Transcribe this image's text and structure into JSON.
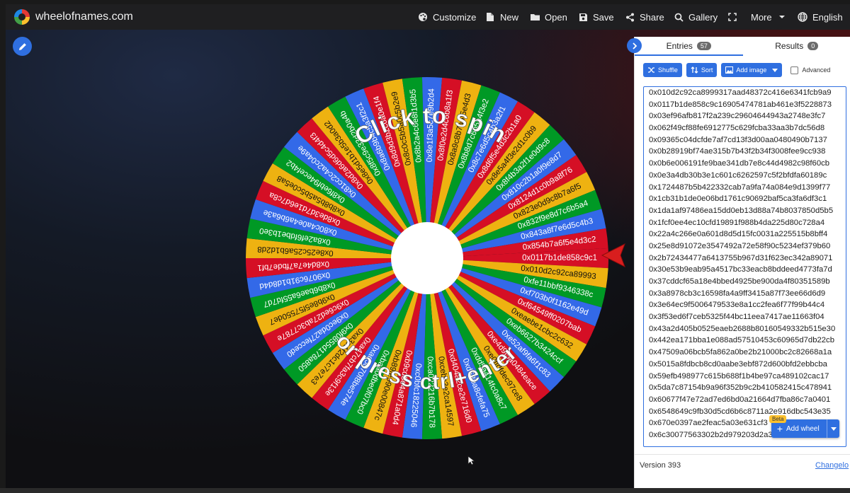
{
  "topbar": {
    "brand": "wheelofnames.com",
    "menu": [
      {
        "label": "Customize",
        "icon": "palette-icon"
      },
      {
        "label": "New",
        "icon": "file-icon"
      },
      {
        "label": "Open",
        "icon": "folder-icon"
      },
      {
        "label": "Save",
        "icon": "save-icon"
      },
      {
        "label": "Share",
        "icon": "share-icon"
      },
      {
        "label": "Gallery",
        "icon": "search-icon"
      },
      {
        "label": "",
        "icon": "fullscreen-icon"
      },
      {
        "label": "More",
        "icon": "chevron-down-icon"
      },
      {
        "label": "English",
        "icon": "globe-icon"
      }
    ]
  },
  "wheel": {
    "line1": "Click to spin",
    "line2": "or press ctrl+enter",
    "slice_colors": [
      "#3369e8",
      "#d50f25",
      "#eeb211",
      "#009925"
    ],
    "slice_labels": [
      "0x0117b1de858c9c1",
      "0x010d2c92ca89993",
      "0xfe11bbf9346338c",
      "0xf703b0f1162e49d",
      "0xf64549ff0207bab",
      "0xeaebe1cbc2c632",
      "0xeb6627b3424ccf",
      "0xe52af9fa6f1c83",
      "0xe4d9f5a0484eace",
      "0xe0ffdfdec97ce8",
      "0xdd5a414fc0a8c7",
      "0xd68ba8cfefa75",
      "0xd404a2ce2e716d0",
      "0xcebc3e2ca14597",
      "0xca022216b7b178",
      "0xc0bfc18225046",
      "0xb9cd8e4a871a0d4",
      "0xb89fe990e00847c",
      "0xbaa0dbe0f07bc0",
      "0xad5870f8be574e",
      "0xa47cb7fa3c9f13e",
      "0xa3e1f2dc1c7e7e3",
      "0x9f0855d178a850",
      "0x9ec0da27fecced0",
      "0x9c6ed27ab3c7787e",
      "0x9b8e5f57550de7",
      "0x8b6bae6a55fd7d7",
      "0x9076c91b1d8d4d",
      "0x8d4e7a7fbde7bf1",
      "0x8e25c25a6b1d2d8",
      "0x8a2ef6fdbe1b3e0",
      "0x80c4a0e4a6b6a3e",
      "0x8de3d7d1e6d7c8a",
      "0x8b8b5a5b5c0e5a8",
      "0x8f6ebf94ecef4b2",
      "0x81cc2c4a2c04a9e",
      "0x8d2a6d6d5c4d4f3",
      "0x8e5d1b1e5b3a0d2",
      "0x8f5c9e33d2b0a4b",
      "0x8a6b9b4c5a3f2c1",
      "0x8d9d3b2c6a0e1f4",
      "0x8c0c5b5a0c5b2e9",
      "0x8b2a4c6e8f1d3b5",
      "0x8e1f3a5c7e9b2d4",
      "0x8f0e2d4c6b8a1f3",
      "0x8a9c8b7a6f5e4d3",
      "0x8b8d7c6b5a4f3e2",
      "0x8c7e6d5c4b3a2f1",
      "0x8d6f5e4d3c2b1a0",
      "0x8e5a4f3e2d1c0b9",
      "0x8f4b3a2f1e0d9c8",
      "0x810c2b1a0f9e8d7",
      "0x8124d1c0b9a8f76",
      "0x823e0d9c8b7a6f5",
      "0x832f9e8d7c6b5a4",
      "0x843a8f7e6d5c4b3",
      "0x854b7a6f5e4d3c2"
    ]
  },
  "panel": {
    "tabs": [
      {
        "label": "Entries",
        "count": "57"
      },
      {
        "label": "Results",
        "count": "0"
      }
    ],
    "buttons": {
      "shuffle": "Shuffle",
      "sort": "Sort",
      "add_image": "Add image",
      "advanced": "Advanced"
    },
    "entries": [
      "0x010d2c92ca8999317aad48372c416e6341fcb9a9",
      "0x0117b1de858c9c16905474781ab461e3f5228873",
      "0x03ef96afb817f2a239c29604644943a2748e3fc7",
      "0x062f49cf88fe6912775c629fcba33aa3b7dc56d8",
      "0x09365c04dcfde7af7cd13f3d00aa0480490b7137",
      "0x0b28919bf74ae315b7b43f2b34f3008fee9cc938",
      "0x0b6e006191fe9bae341db7e8c44d4982c98f60cb",
      "0x0e3a4db30b3e1c601c6262597c5f2bfdfa60189c",
      "0x1724487b5b422332cab7a9fa74a084e9d1399f77",
      "0x1cb31b1de0e06bd1761c90692baf5ca3fa6df3c1",
      "0x1da1af97486ea15dd0eb13d88a74b8037850d5b5",
      "0x1fcf0ee4ec10cfd19891f988b4da225d80c728a4",
      "0x22a4c266e0a601d8d5d15fc0031a225515b8bff4",
      "0x25e8d91072e3547492a72e58f90c5234ef379b60",
      "0x2b72434477a6413755b967d31f623ec342a89071",
      "0x30e53b9eab95a4517bc33eacb8bddeed4773fa7d",
      "0x37cddcf65a18e4bbed4925be900da4f80351589b",
      "0x3a8978cb3c16598fa4a9ff3415a87f73ee66d6d9",
      "0x3e64ec9f5006479533e8a1cc2fea6f77f99b44c4",
      "0x3f53ed6f7ceb5325f44bc11eea7417ae11663f04",
      "0x43a2d405b0525eaeb2688b80160549332b515e30",
      "0x442ea171bba1e088ad57510453c60965d7db22cb",
      "0x47509a06bcb5fa862a0be2b21000bc2c82668a1a",
      "0x5015a8fdbcb8cd0aabe3ebf872d600bfd2ebbcba",
      "0x59efb498977c615b688f1b4be97ca489102cac17",
      "0x5da7c87154b9a96f352b9c2b410582415c478941",
      "0x60677f47e72ad7ed6bd0a21664d7fba86c7a0401",
      "0x6548649c9fb30d5cd6b6c8711a2e916dbc543e35",
      "0x670e0397ae2feac5a03e631cf3",
      "0x6c30077563302b2d979203d2a34d44e8de2b485c"
    ],
    "add_wheel": "Add wheel",
    "beta": "Beta",
    "version": "Version 393",
    "changelog": "Changelo"
  }
}
